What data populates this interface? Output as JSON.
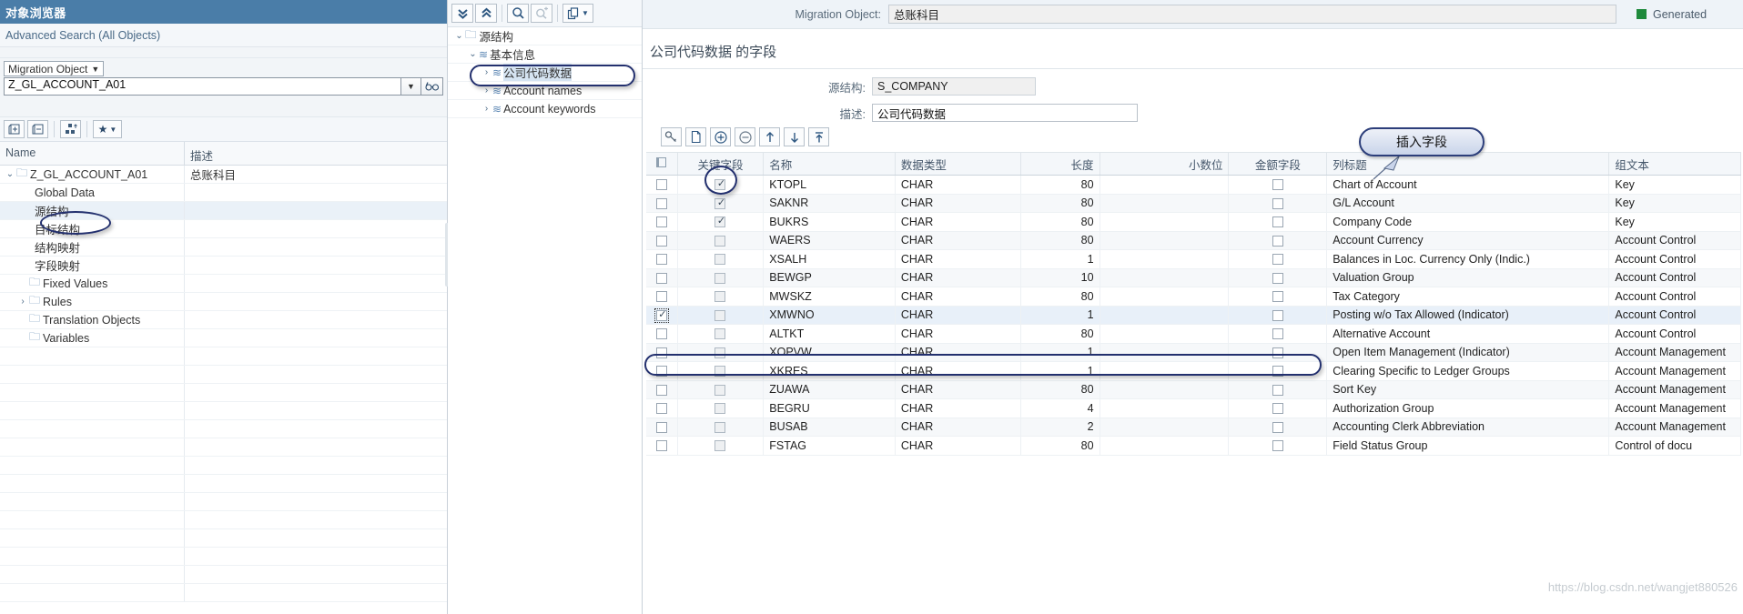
{
  "left_panel": {
    "title": "对象浏览器",
    "advanced_search": "Advanced Search (All Objects)",
    "object_type_select": "Migration Object",
    "search_value": "Z_GL_ACCOUNT_A01",
    "toolbar": [
      {
        "name": "expand-node-button",
        "glyph": "⊞"
      },
      {
        "name": "collapse-node-button",
        "glyph": "⊟"
      },
      {
        "name": "hierarchy-up-button",
        "glyph": "⇪"
      },
      {
        "name": "favorites-button",
        "glyph": "★"
      }
    ],
    "columns": [
      "Name",
      "描述"
    ],
    "rows": [
      {
        "indent": 0,
        "twisty": "v",
        "icon": "folder",
        "name": "Z_GL_ACCOUNT_A01",
        "desc": "总账科目",
        "selected": false
      },
      {
        "indent": 1,
        "twisty": "",
        "icon": "",
        "name": "Global Data",
        "desc": "",
        "selected": false
      },
      {
        "indent": 1,
        "twisty": "",
        "icon": "",
        "name": "源结构",
        "desc": "",
        "selected": true
      },
      {
        "indent": 1,
        "twisty": "",
        "icon": "",
        "name": "目标结构",
        "desc": "",
        "selected": false
      },
      {
        "indent": 1,
        "twisty": "",
        "icon": "",
        "name": "结构映射",
        "desc": "",
        "selected": false
      },
      {
        "indent": 1,
        "twisty": "",
        "icon": "",
        "name": "字段映射",
        "desc": "",
        "selected": false
      },
      {
        "indent": 1,
        "twisty": "",
        "icon": "folder",
        "name": "Fixed Values",
        "desc": "",
        "selected": false
      },
      {
        "indent": 1,
        "twisty": ">",
        "icon": "folder",
        "name": "Rules",
        "desc": "",
        "selected": false
      },
      {
        "indent": 1,
        "twisty": "",
        "icon": "folder",
        "name": "Translation Objects",
        "desc": "",
        "selected": false
      },
      {
        "indent": 1,
        "twisty": "",
        "icon": "folder",
        "name": "Variables",
        "desc": "",
        "selected": false
      }
    ]
  },
  "middle_panel": {
    "toolbar": [
      {
        "name": "collapse-all-button",
        "glyph": "»"
      },
      {
        "name": "expand-all-button",
        "glyph": "«"
      },
      {
        "name": "search-button",
        "glyph": "search"
      },
      {
        "name": "search-next-button",
        "glyph": "search-plus"
      },
      {
        "name": "copy-button",
        "glyph": "copy"
      }
    ],
    "rows": [
      {
        "indent": 0,
        "twisty": "v",
        "icon": "folder",
        "name": "源结构",
        "highlighted": false
      },
      {
        "indent": 1,
        "twisty": "v",
        "icon": "wave",
        "name": "基本信息",
        "highlighted": false
      },
      {
        "indent": 2,
        "twisty": ">",
        "icon": "wave",
        "name": "公司代码数据",
        "highlighted": true
      },
      {
        "indent": 2,
        "twisty": ">",
        "icon": "wave",
        "name": "Account names",
        "highlighted": false
      },
      {
        "indent": 2,
        "twisty": ">",
        "icon": "wave",
        "name": "Account keywords",
        "highlighted": false
      }
    ]
  },
  "right_panel": {
    "migration_object_label": "Migration Object:",
    "migration_object_value": "总账科目",
    "status_text": "Generated",
    "status_color": "#1f8a3c",
    "section_title": "公司代码数据 的字段",
    "source_structure_label": "源结构:",
    "source_structure_value": "S_COMPANY",
    "description_label": "描述:",
    "description_value": "公司代码数据",
    "callout_text": "插入字段",
    "grid_toolbar": [
      {
        "name": "find-button",
        "glyph": "key"
      },
      {
        "name": "new-document-button",
        "glyph": "doc"
      },
      {
        "name": "insert-field-button",
        "glyph": "plus"
      },
      {
        "name": "delete-field-button",
        "glyph": "minus"
      },
      {
        "name": "move-up-button",
        "glyph": "up"
      },
      {
        "name": "move-down-button",
        "glyph": "down"
      },
      {
        "name": "move-to-top-button",
        "glyph": "top"
      }
    ],
    "grid": {
      "columns": [
        {
          "key": "select",
          "label": "",
          "icon": "select-all-icon"
        },
        {
          "key": "keyfield",
          "label": "关键字段"
        },
        {
          "key": "name",
          "label": "名称"
        },
        {
          "key": "datatype",
          "label": "数据类型"
        },
        {
          "key": "length",
          "label": "长度"
        },
        {
          "key": "decimals",
          "label": "小数位"
        },
        {
          "key": "amount",
          "label": "金额字段"
        },
        {
          "key": "coltitle",
          "label": "列标题"
        },
        {
          "key": "grouptext",
          "label": "组文本"
        }
      ],
      "rows": [
        {
          "select": false,
          "keyfield": true,
          "name": "KTOPL",
          "datatype": "CHAR",
          "length": "80",
          "decimals": "",
          "amount": false,
          "coltitle": "Chart of Account",
          "grouptext": "Key"
        },
        {
          "select": false,
          "keyfield": true,
          "name": "SAKNR",
          "datatype": "CHAR",
          "length": "80",
          "decimals": "",
          "amount": false,
          "coltitle": "G/L Account",
          "grouptext": "Key"
        },
        {
          "select": false,
          "keyfield": true,
          "name": "BUKRS",
          "datatype": "CHAR",
          "length": "80",
          "decimals": "",
          "amount": false,
          "coltitle": "Company Code",
          "grouptext": "Key"
        },
        {
          "select": false,
          "keyfield": false,
          "name": "WAERS",
          "datatype": "CHAR",
          "length": "80",
          "decimals": "",
          "amount": false,
          "coltitle": "Account Currency",
          "grouptext": "Account Control"
        },
        {
          "select": false,
          "keyfield": false,
          "name": "XSALH",
          "datatype": "CHAR",
          "length": "1",
          "decimals": "",
          "amount": false,
          "coltitle": "Balances in Loc. Currency Only (Indic.)",
          "grouptext": "Account Control"
        },
        {
          "select": false,
          "keyfield": false,
          "name": "BEWGP",
          "datatype": "CHAR",
          "length": "10",
          "decimals": "",
          "amount": false,
          "coltitle": "Valuation Group",
          "grouptext": "Account Control"
        },
        {
          "select": false,
          "keyfield": false,
          "name": "MWSKZ",
          "datatype": "CHAR",
          "length": "80",
          "decimals": "",
          "amount": false,
          "coltitle": "Tax Category",
          "grouptext": "Account Control"
        },
        {
          "select": true,
          "keyfield": false,
          "name": "XMWNO",
          "datatype": "CHAR",
          "length": "1",
          "decimals": "",
          "amount": false,
          "coltitle": "Posting w/o Tax Allowed (Indicator)",
          "grouptext": "Account Control"
        },
        {
          "select": false,
          "keyfield": false,
          "name": "ALTKT",
          "datatype": "CHAR",
          "length": "80",
          "decimals": "",
          "amount": false,
          "coltitle": "Alternative Account",
          "grouptext": "Account Control"
        },
        {
          "select": false,
          "keyfield": false,
          "name": "XOPVW",
          "datatype": "CHAR",
          "length": "1",
          "decimals": "",
          "amount": false,
          "coltitle": "Open Item Management (Indicator)",
          "grouptext": "Account Management"
        },
        {
          "select": false,
          "keyfield": false,
          "name": "XKRES",
          "datatype": "CHAR",
          "length": "1",
          "decimals": "",
          "amount": false,
          "coltitle": "Clearing Specific to Ledger Groups",
          "grouptext": "Account Management"
        },
        {
          "select": false,
          "keyfield": false,
          "name": "ZUAWA",
          "datatype": "CHAR",
          "length": "80",
          "decimals": "",
          "amount": false,
          "coltitle": "Sort Key",
          "grouptext": "Account Management"
        },
        {
          "select": false,
          "keyfield": false,
          "name": "BEGRU",
          "datatype": "CHAR",
          "length": "4",
          "decimals": "",
          "amount": false,
          "coltitle": "Authorization Group",
          "grouptext": "Account Management"
        },
        {
          "select": false,
          "keyfield": false,
          "name": "BUSAB",
          "datatype": "CHAR",
          "length": "2",
          "decimals": "",
          "amount": false,
          "coltitle": "Accounting Clerk Abbreviation",
          "grouptext": "Account Management"
        },
        {
          "select": false,
          "keyfield": false,
          "name": "FSTAG",
          "datatype": "CHAR",
          "length": "80",
          "decimals": "",
          "amount": false,
          "coltitle": "Field Status Group",
          "grouptext": "Control of docu"
        }
      ]
    }
  },
  "watermark": "https://blog.csdn.net/wangjet880526"
}
